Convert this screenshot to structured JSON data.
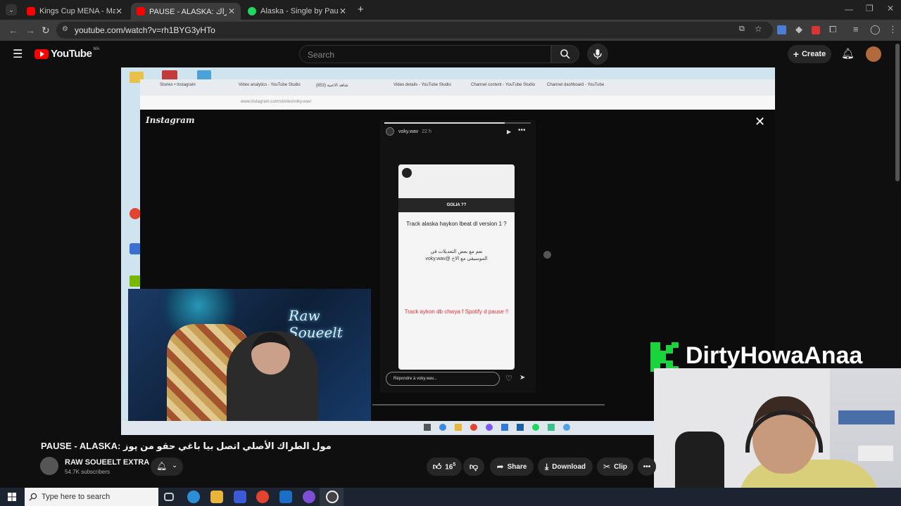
{
  "browser": {
    "tabs": [
      {
        "title": "Kings Cup MENA - Matchday"
      },
      {
        "title": "PAUSE - ALASKA: مول الطراك"
      },
      {
        "title": "Alaska - Single by Pause | Spotify"
      }
    ],
    "url": "youtube.com/watch?v=rh1BYG3yHTo"
  },
  "youtube": {
    "logo_text": "YouTube",
    "region": "MA",
    "search_placeholder": "Search",
    "create_label": "Create"
  },
  "video": {
    "inner_browser_url": "www.instagram.com/stories/voky.wav/",
    "inner_tabs": [
      "Stories • Instagram",
      "Video analytics - YouTube Studio",
      "(853) شاهد الاغنية",
      "Video details - YouTube Studio",
      "Channel content - YouTube Studio",
      "Channel dashboard - YouTube"
    ],
    "instagram_logo": "Instagram",
    "story": {
      "progress": 0.82,
      "user": "voky.wav",
      "time": "22 h",
      "card_header": "GOLIA ??",
      "question": "Track alaska haykon lbeat dl version 1 ?",
      "arabic_line1": "نعم مع بعض التعديلات في",
      "arabic_line2": "voky.wav@ الموسيقى مع الاخ",
      "red_text": "Track aykon db chwya f Spotify d pause !!",
      "reply_placeholder": "Répondre à voky.wav..."
    },
    "webcam_brand": "Raw Soueelt",
    "overlay_brand": "DirtyHowaAnaa"
  },
  "meta": {
    "title": "PAUSE - ALASKA: مول الطراك الأصلي اتصل بيا باغي حقو من پوز",
    "channel_name": "RAW SOUEELT EXTRA",
    "subscribers": "54.7K subscribers",
    "likes": "16",
    "like_suffix": "5",
    "share_label": "Share",
    "download_label": "Download",
    "clip_label": "Clip"
  },
  "taskbar": {
    "search_placeholder": "Type here to search"
  },
  "colors": {
    "youtube_red": "#ff0000",
    "brand_green": "#19d43a",
    "story_red": "#e0323a"
  }
}
